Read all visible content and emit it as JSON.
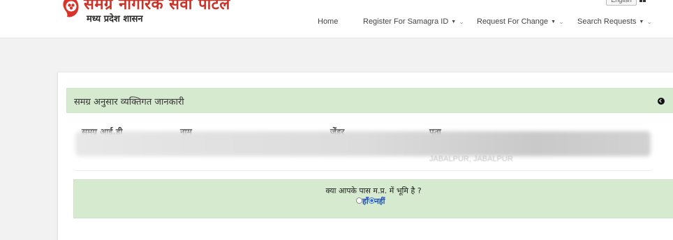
{
  "header": {
    "brand_title": "समग्र नागरिक सेवा पोर्टल",
    "brand_subtitle": "मध्य प्रदेश शासन",
    "language_button": "English",
    "nav": [
      {
        "label": "Home"
      },
      {
        "label": "Register For Samagra ID"
      },
      {
        "label": "Request For Change"
      },
      {
        "label": "Search Requests"
      }
    ]
  },
  "panel": {
    "title": "समग्र अनुसार व्यक्तिगत जानकारी",
    "columns": [
      "समग्र आई.डी",
      "नाम",
      "जेंडर",
      "पता"
    ],
    "row_address_partial": "JABALPUR, JABALPUR"
  },
  "question": {
    "text": "क्या आपके पास म.प्र. में भूमि है ?",
    "options": [
      "हाँ",
      "नहीं"
    ],
    "selected": "नहीं"
  },
  "colors": {
    "brand_red": "#cc3127",
    "panel_green": "#d6eacf",
    "radio_blue": "#2a6fd6",
    "option_text_blue": "#1f4fb5"
  },
  "icons": {
    "logo": "samagra-logo",
    "panel_toggle": "circle-chevron-icon",
    "nav_dropdown": "caret-down-icon",
    "header_extra": "grid-icon"
  }
}
